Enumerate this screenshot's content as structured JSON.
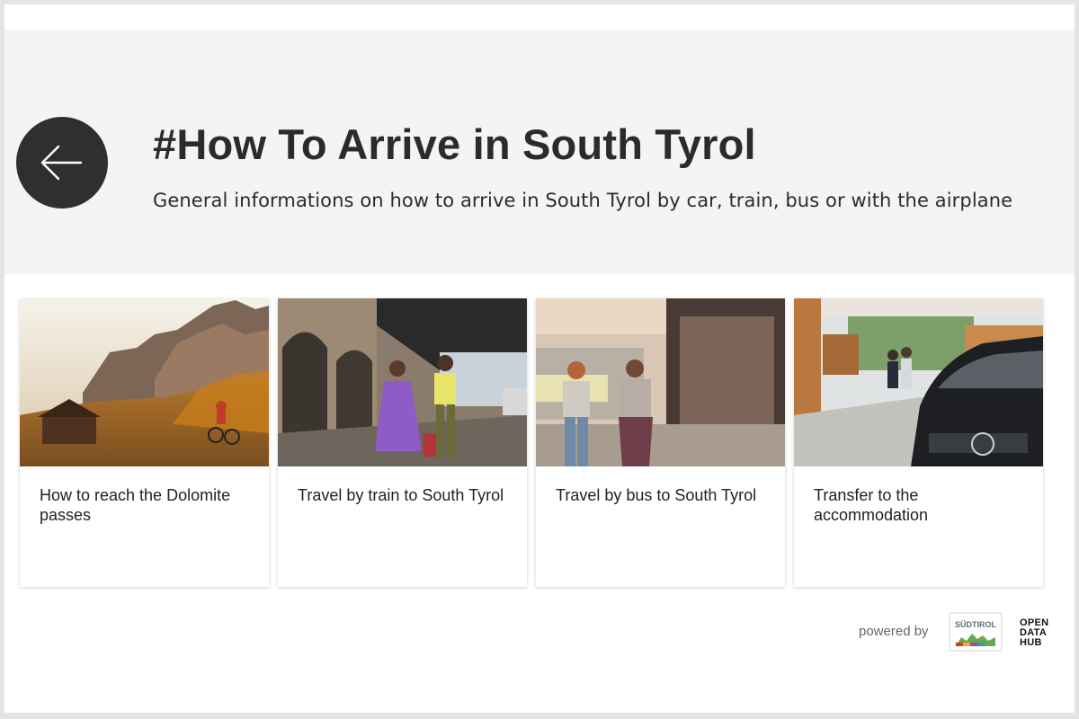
{
  "header": {
    "title": "#How To Arrive in South Tyrol",
    "subtitle": "General informations on how to arrive in South Tyrol by car, train, bus or with the airplane"
  },
  "back_button": {
    "icon": "arrow-left-icon"
  },
  "cards": [
    {
      "label": "How to reach the Dolomite passes",
      "image": "dolomites-mountain-biker-photo"
    },
    {
      "label": "Travel by train to South Tyrol",
      "image": "train-station-couple-photo"
    },
    {
      "label": "Travel by bus to South Tyrol",
      "image": "bus-station-women-photo"
    },
    {
      "label": "Transfer to the accommodation",
      "image": "car-transfer-photo"
    }
  ],
  "footer": {
    "powered_by": "powered by",
    "logo_suedtirol": "SÜDTIROL",
    "logo_odh": [
      "OPEN",
      "DATA",
      "HUB"
    ]
  },
  "colors": {
    "header_bg": "#f4f4f4",
    "back_button_bg": "#2f2f2f",
    "title_text": "#2b2b2b"
  }
}
